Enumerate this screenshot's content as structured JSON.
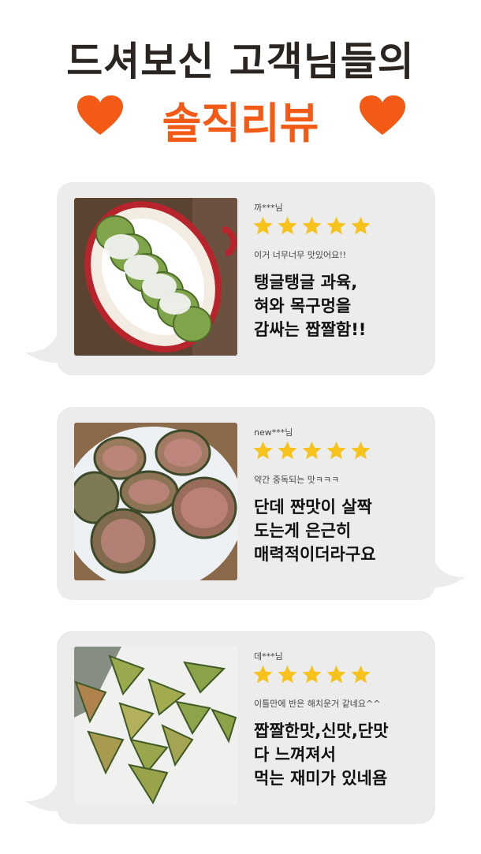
{
  "header": {
    "line1": "드셔보신 고객님들의",
    "line2": "솔직리뷰",
    "heart_color": "#f25a16"
  },
  "colors": {
    "accent": "#f25a16",
    "star": "#f6c21b",
    "bubble": "#ececec"
  },
  "reviews": [
    {
      "user": "까***님",
      "rating": 5,
      "short": "이거 너무너무 맛있어요!!",
      "headline": [
        "탱글탱글 과육,",
        "혀와 목구멍을",
        "감싸는 짭짤함!!"
      ]
    },
    {
      "user": "new***님",
      "rating": 5,
      "short": "약간 중독되는 맛ㅋㅋㅋ",
      "headline": [
        "단데 짠맛이 살짝",
        "도는게 은근히",
        "매력적이더라구요"
      ]
    },
    {
      "user": "데***님",
      "rating": 5,
      "short": "이틀만에 반은 해치운거 같네요^^",
      "headline": [
        "짭짤한맛,신맛,단맛",
        "다 느껴져서",
        "먹는 재미가 있네욤"
      ]
    }
  ]
}
